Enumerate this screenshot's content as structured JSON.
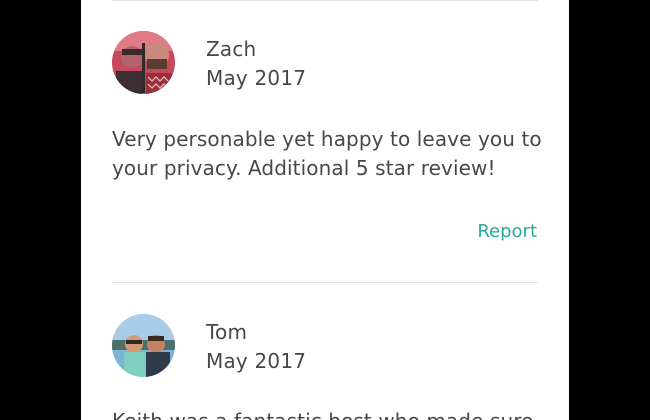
{
  "reviews": [
    {
      "name": "Zach",
      "date": "May 2017",
      "text": "Very personable yet happy to leave you to your privacy. Additional 5 star review!",
      "report_label": "Report"
    },
    {
      "name": "Tom",
      "date": "May 2017",
      "text": "Keith was a fantastic host who made sure"
    }
  ],
  "colors": {
    "background": "#000000",
    "card": "#ffffff",
    "text": "#484848",
    "link": "#2aa79c",
    "divider": "#e4e4e4"
  }
}
